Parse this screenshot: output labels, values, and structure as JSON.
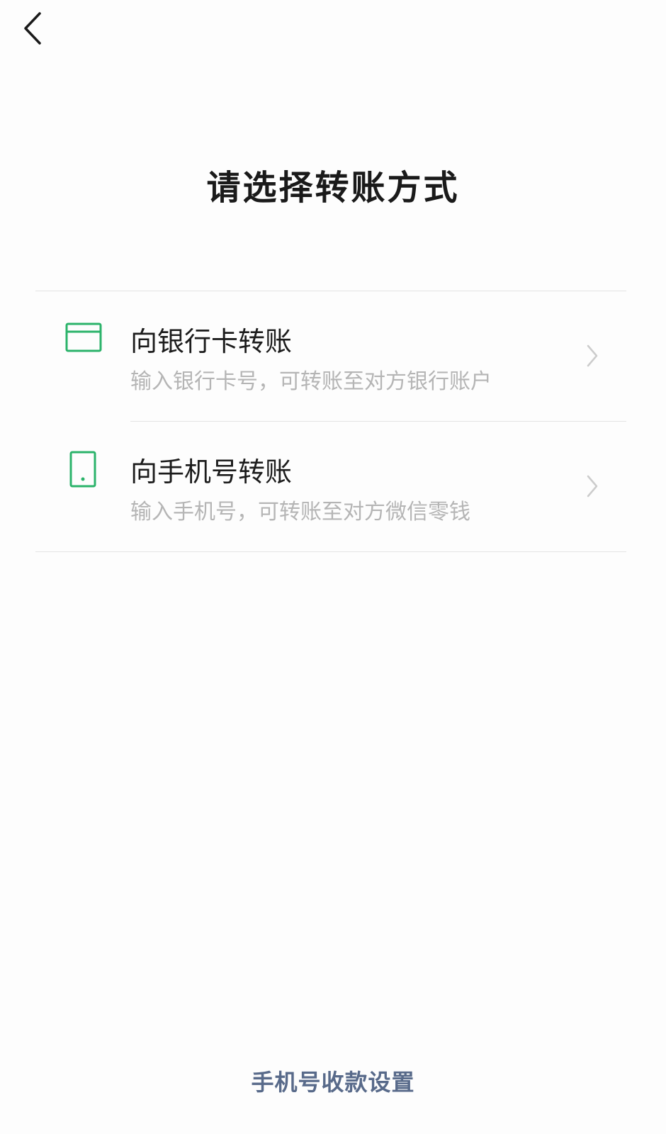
{
  "header": {
    "back_icon": "chevron-left-icon",
    "title": "请选择转账方式"
  },
  "options": [
    {
      "icon": "bank-card-icon",
      "title": "向银行卡转账",
      "description": "输入银行卡号，可转账至对方银行账户",
      "chevron_icon": "chevron-right-icon"
    },
    {
      "icon": "mobile-phone-icon",
      "title": "向手机号转账",
      "description": "输入手机号，可转账至对方微信零钱",
      "chevron_icon": "chevron-right-icon"
    }
  ],
  "footer": {
    "link_label": "手机号收款设置"
  },
  "colors": {
    "accent_green": "#2bb36a",
    "footer_link": "#586a8a",
    "secondary_text": "#b5b5b5",
    "divider": "#e4e4e4"
  }
}
